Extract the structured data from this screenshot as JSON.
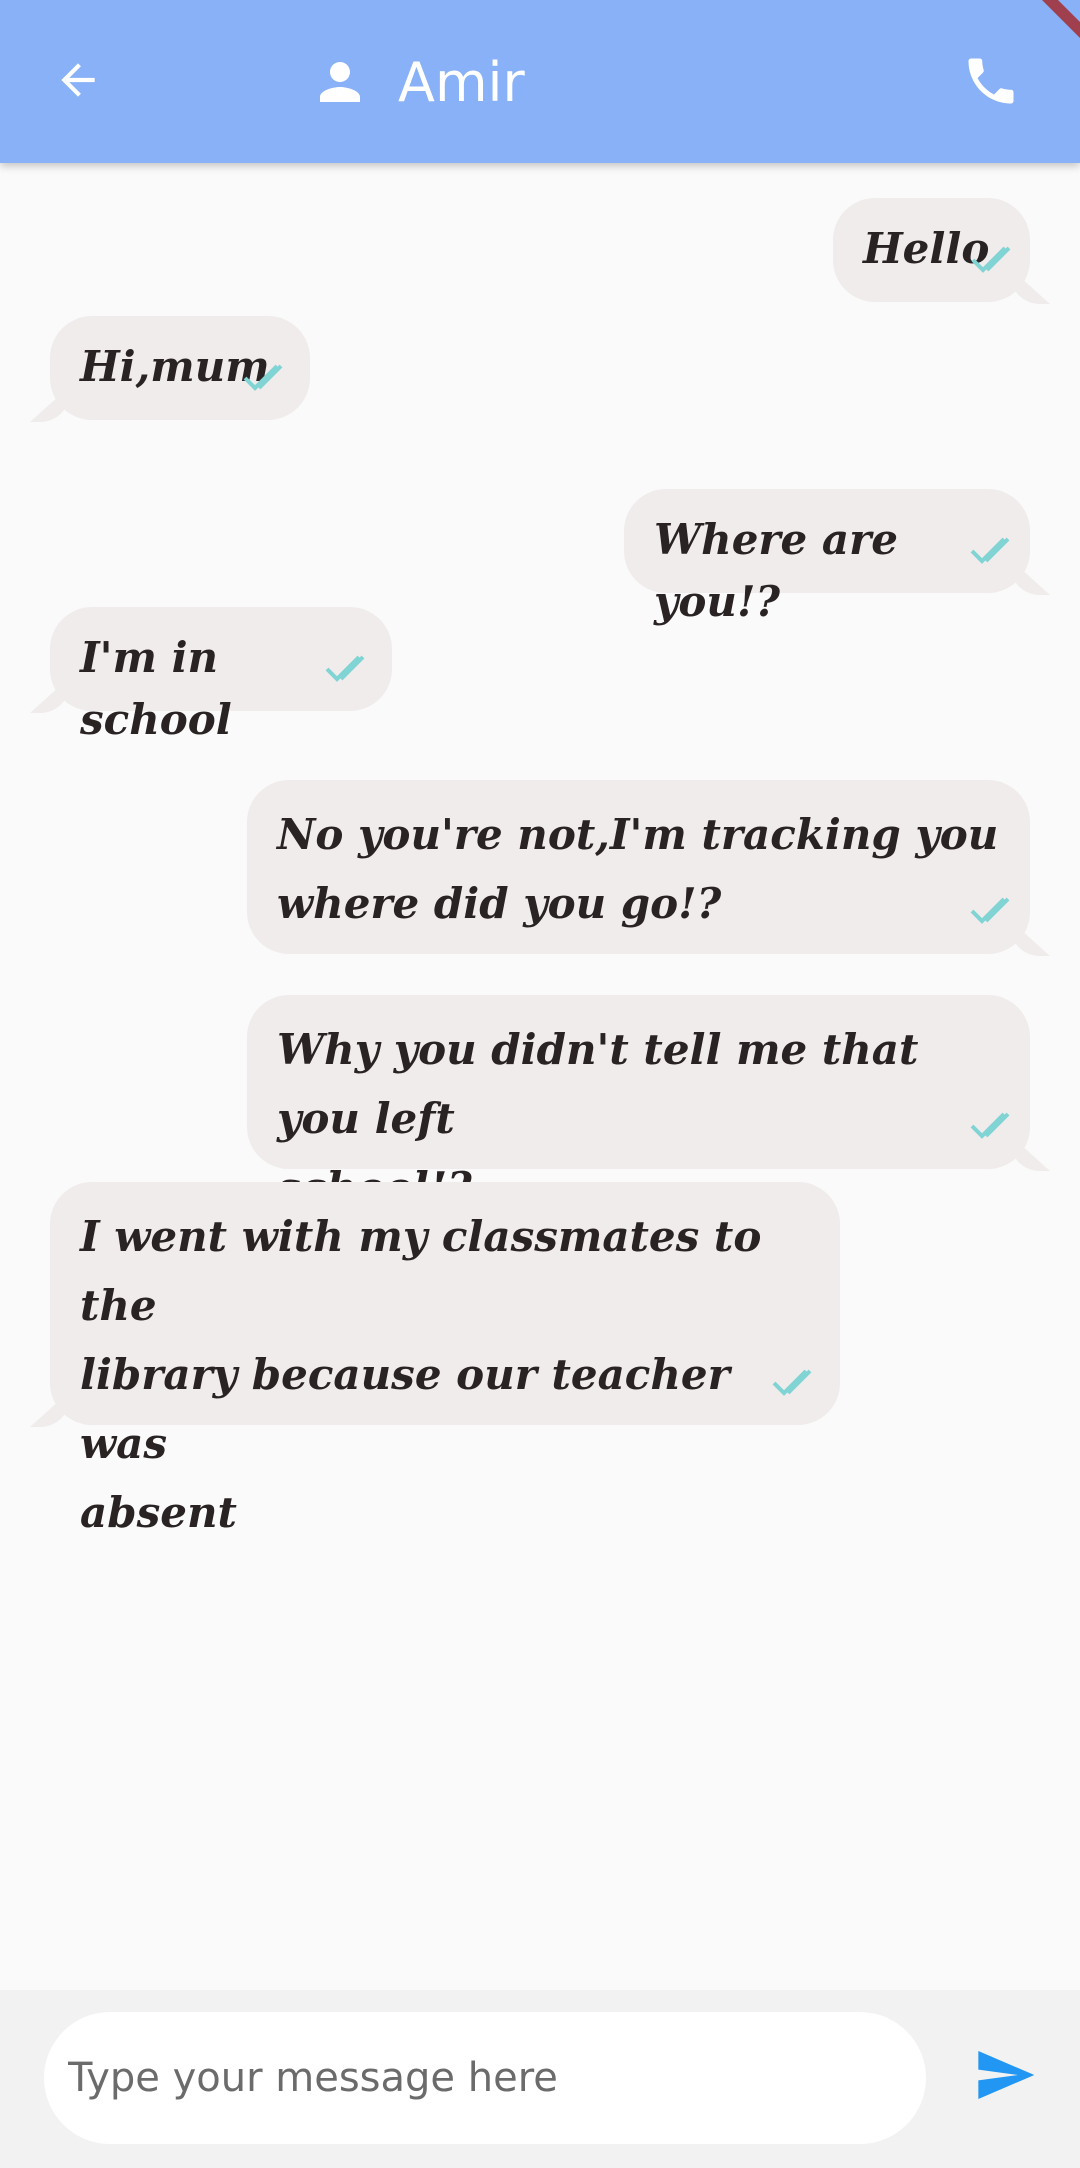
{
  "header": {
    "contact_name": "Amir",
    "icons": {
      "back": "arrow-back-icon",
      "person": "person-icon",
      "call": "phone-icon"
    },
    "background_color": "#88b1f7"
  },
  "messages": [
    {
      "sender": "me",
      "text": "Hello",
      "status": "read"
    },
    {
      "sender": "other",
      "text": "Hi,mum",
      "status": "read"
    },
    {
      "sender": "me",
      "text": "Where are you!?",
      "status": "read"
    },
    {
      "sender": "other",
      "text": "I'm in school",
      "status": "read"
    },
    {
      "sender": "me",
      "text": "No you're not,I'm tracking you\nwhere did you go!?",
      "status": "read"
    },
    {
      "sender": "me",
      "text": "Why you didn't tell me that you left\nschool!?",
      "status": "read"
    },
    {
      "sender": "other",
      "text": "I went with my classmates to the\nlibrary because our teacher was\nabsent",
      "status": "read"
    }
  ],
  "composer": {
    "placeholder": "Type your message here",
    "send_icon": "send-icon",
    "send_color": "#2196f3"
  },
  "colors": {
    "bubble": "#f0eceb",
    "tick": "#80d4d4",
    "text": "#2a2323"
  }
}
